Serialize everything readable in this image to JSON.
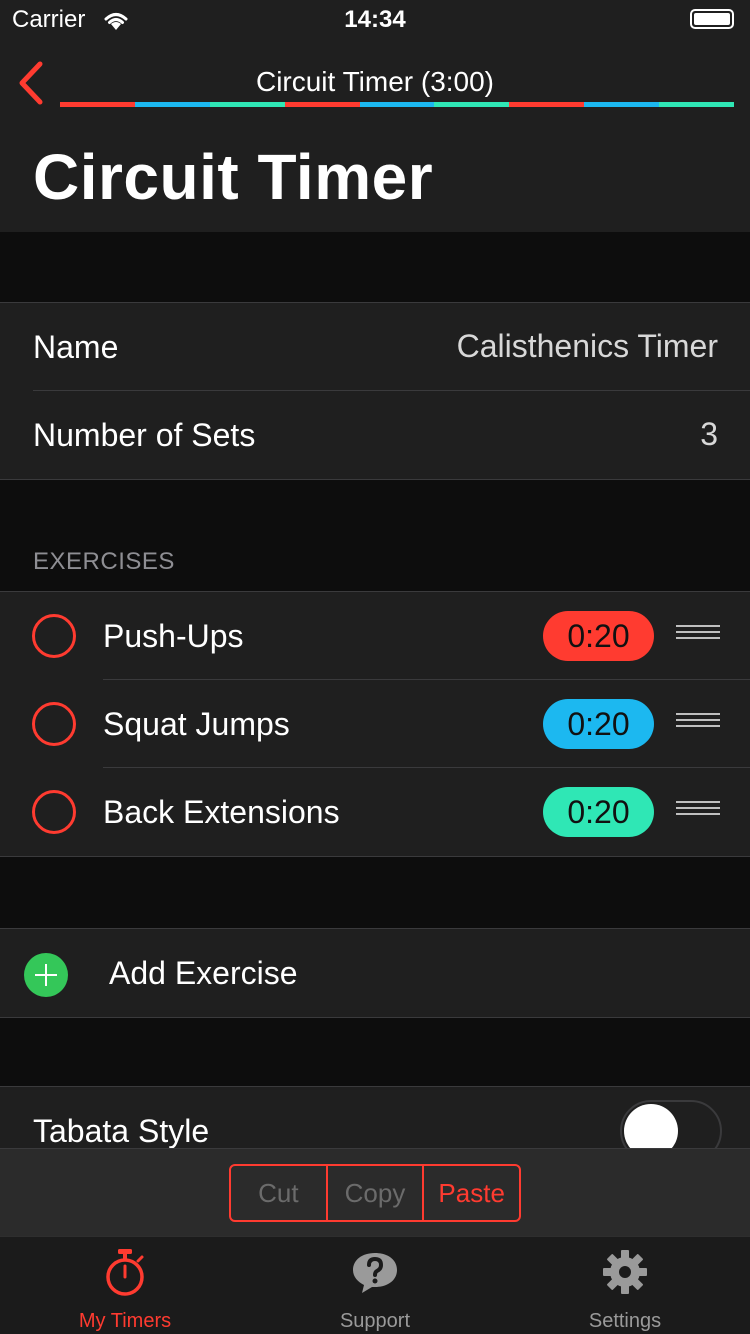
{
  "status_bar": {
    "carrier": "Carrier",
    "time": "14:34"
  },
  "nav": {
    "title": "Circuit Timer (3:00)",
    "large_title": "Circuit Timer",
    "progress_colors": [
      "#ff3b30",
      "#1cb8f0",
      "#2fe7b5",
      "#ff3b30",
      "#1cb8f0",
      "#2fe7b5",
      "#ff3b30",
      "#1cb8f0",
      "#2fe7b5"
    ]
  },
  "settings": {
    "name_label": "Name",
    "name_value": "Calisthenics Timer",
    "sets_label": "Number of Sets",
    "sets_value": "3"
  },
  "exercises_header": "EXERCISES",
  "exercises": [
    {
      "name": "Push-Ups",
      "time": "0:20",
      "color": "#ff3b30"
    },
    {
      "name": "Squat Jumps",
      "time": "0:20",
      "color": "#1cb8f0"
    },
    {
      "name": "Back Extensions",
      "time": "0:20",
      "color": "#2fe7b5"
    }
  ],
  "add_exercise": "Add Exercise",
  "tabata": {
    "label": "Tabata Style",
    "on": false
  },
  "edit_menu": {
    "cut": "Cut",
    "copy": "Copy",
    "paste": "Paste"
  },
  "tabs": [
    {
      "label": "My Timers",
      "icon": "stopwatch-icon",
      "active": true
    },
    {
      "label": "Support",
      "icon": "question-bubble-icon",
      "active": false
    },
    {
      "label": "Settings",
      "icon": "gear-icon",
      "active": false
    }
  ],
  "colors": {
    "accent": "#ff3b30",
    "add_green": "#34c759",
    "background": "#0d0d0d",
    "cell": "#1f1f1f"
  }
}
